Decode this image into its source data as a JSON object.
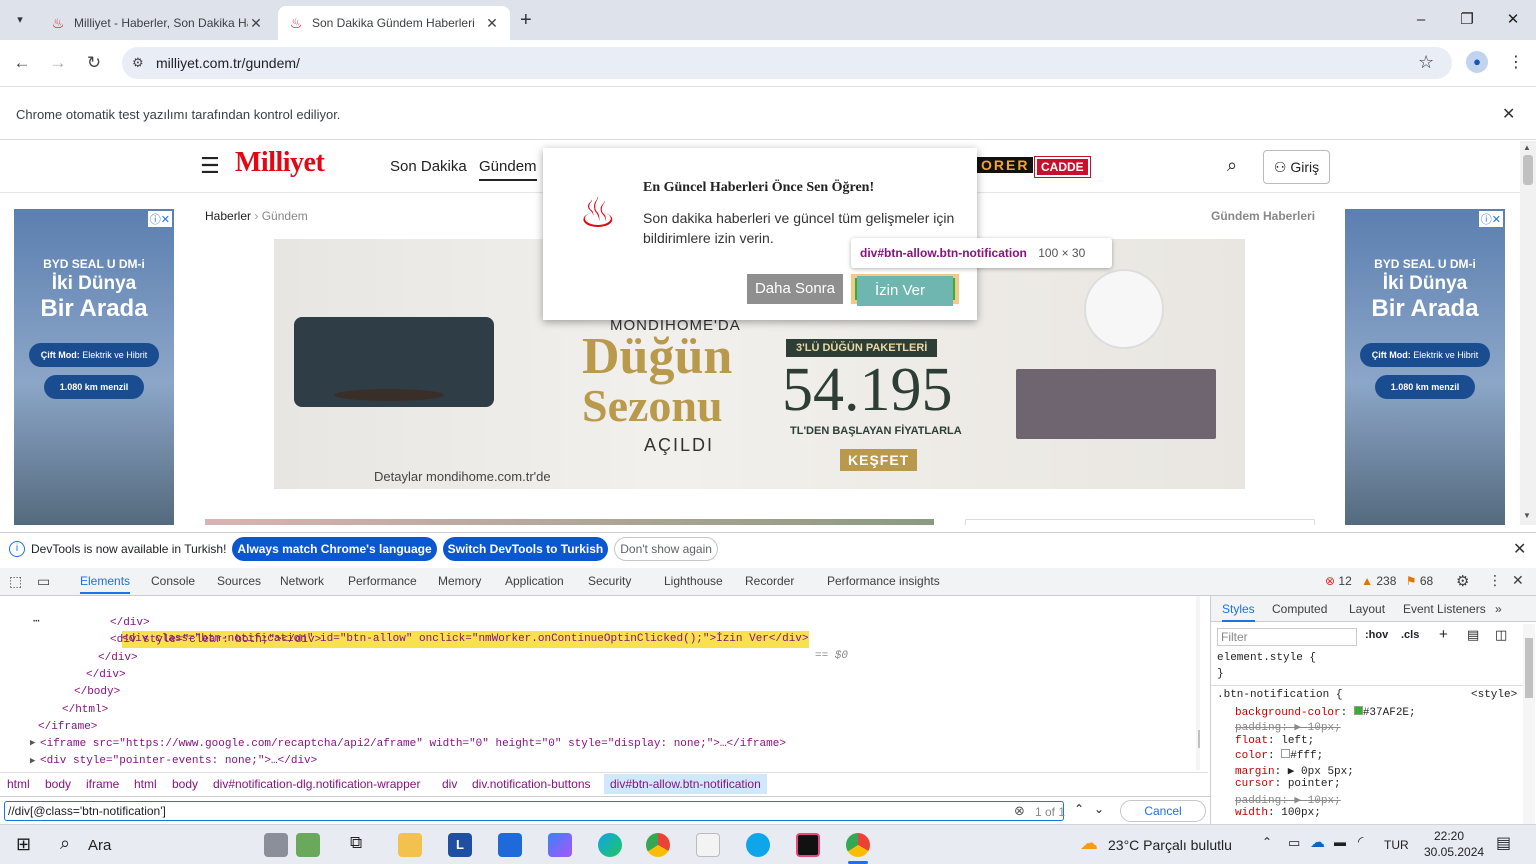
{
  "tabs": [
    {
      "title": "Milliyet - Haberler, Son Dakika Haberleri",
      "active": false
    },
    {
      "title": "Son Dakika Gündem Haberleri",
      "active": true
    }
  ],
  "window": {
    "minimize": "–",
    "restore": "❐",
    "close": "✕"
  },
  "address": {
    "url": "milliyet.com.tr/gundem/"
  },
  "infobar": {
    "text": "Chrome otomatik test yazılımı tarafından kontrol ediliyor."
  },
  "site": {
    "logo": "Milliyet",
    "nav": [
      "Son Dakika",
      "Gündem"
    ],
    "partner_logos": [
      "ORER",
      "CADDE"
    ],
    "login": "Giriş",
    "breadcrumb": [
      "Haberler",
      "Gündem"
    ],
    "section_title": "Gündem Haberleri"
  },
  "side_ad": {
    "line1": "BYD SEAL U DM-i",
    "line2": "İki Dünya",
    "line3": "Bir Arada",
    "pill1_label": "Çift Mod:",
    "pill1_text": "Elektrik ve Hibrit",
    "pill2": "1.080 km menzil"
  },
  "banner": {
    "brand": "MONDIHOME'DA",
    "headline1": "Düğün",
    "headline2": "Sezonu",
    "sub": "AÇILDI",
    "tag": "3'LÜ DÜĞÜN PAKETLERİ",
    "price": "54.195",
    "price_note": "TL'DEN BAŞLAYAN FİYATLARLA",
    "cta": "KEŞFET",
    "footer": "Detaylar mondihome.com.tr'de"
  },
  "popup": {
    "title": "En Güncel Haberleri Önce Sen Öğren!",
    "body": "Son dakika haberleri ve güncel tüm gelişmeler için bildirimlere izin verin.",
    "later": "Daha Sonra",
    "allow": "İzin Ver"
  },
  "tooltip": {
    "selector": "div#btn-allow.btn-notification",
    "size": "100 × 30"
  },
  "devtools": {
    "infobar": {
      "text": "DevTools is now available in Turkish!",
      "btn1": "Always match Chrome's language",
      "btn2": "Switch DevTools to Turkish",
      "btn3": "Don't show again"
    },
    "tabs": [
      "Elements",
      "Console",
      "Sources",
      "Network",
      "Performance",
      "Memory",
      "Application",
      "Security",
      "Lighthouse",
      "Recorder",
      "Performance insights"
    ],
    "counts": {
      "errors": "12",
      "warnings": "238",
      "issues": "68"
    },
    "breadcrumbs": [
      "html",
      "body",
      "iframe",
      "html",
      "body",
      "div#notification-dlg.notification-wrapper",
      "div",
      "div.notification-buttons",
      "div#btn-allow.btn-notification"
    ],
    "search": {
      "value": "//div[@class='btn-notification']",
      "count": "1 of 1",
      "cancel": "Cancel"
    },
    "style_tabs": [
      "Styles",
      "Computed",
      "Layout",
      "Event Listeners"
    ],
    "filter_placeholder": "Filter",
    "hov": ":hov",
    "cls": ".cls",
    "element_style": "element.style {",
    "rule_selector": ".btn-notification {",
    "rule_source": "<style>",
    "props": [
      {
        "name": "background-color",
        "value": "#37AF2E",
        "strike": false
      },
      {
        "name": "padding",
        "value": "10px",
        "strike": true
      },
      {
        "name": "float",
        "value": "left",
        "strike": false
      },
      {
        "name": "color",
        "value": "#fff",
        "strike": false
      },
      {
        "name": "margin",
        "value": "0px 5px",
        "strike": false
      },
      {
        "name": "cursor",
        "value": "pointer",
        "strike": false
      },
      {
        "name": "padding",
        "value": "10px",
        "strike": true
      },
      {
        "name": "width",
        "value": "100px",
        "strike": false
      }
    ],
    "dom_lines": [
      {
        "html": "selected"
      },
      {
        "text": "</div>"
      },
      {
        "text": "<div style=\"clear: both;\"></div>"
      },
      {
        "text": "</div>"
      },
      {
        "text": "</div>"
      },
      {
        "text": "</body>"
      },
      {
        "text": "</html>"
      },
      {
        "text": "</iframe>"
      },
      {
        "text": "<iframe src=\"https://www.google.com/recaptcha/api2/aframe\" width=\"0\" height=\"0\" style=\"display: none;\">…</iframe>"
      },
      {
        "text": "<div style=\"pointer-events: none;\">…</div>"
      }
    ],
    "selected_line": "<div class=\"btn-notification\" id=\"btn-allow\" onclick=\"nmWorker.onContinueOptinClicked();\">İzin Ver</div>",
    "selected_suffix": "== $0"
  },
  "taskbar": {
    "search": "Ara",
    "weather": "23°C  Parçalı bulutlu",
    "lang": "TUR",
    "time": "22:20",
    "date": "30.05.2024"
  },
  "colors": {
    "accent": "#1a73e8",
    "brand": "#e30613",
    "allow_bg": "#37AF2E"
  }
}
